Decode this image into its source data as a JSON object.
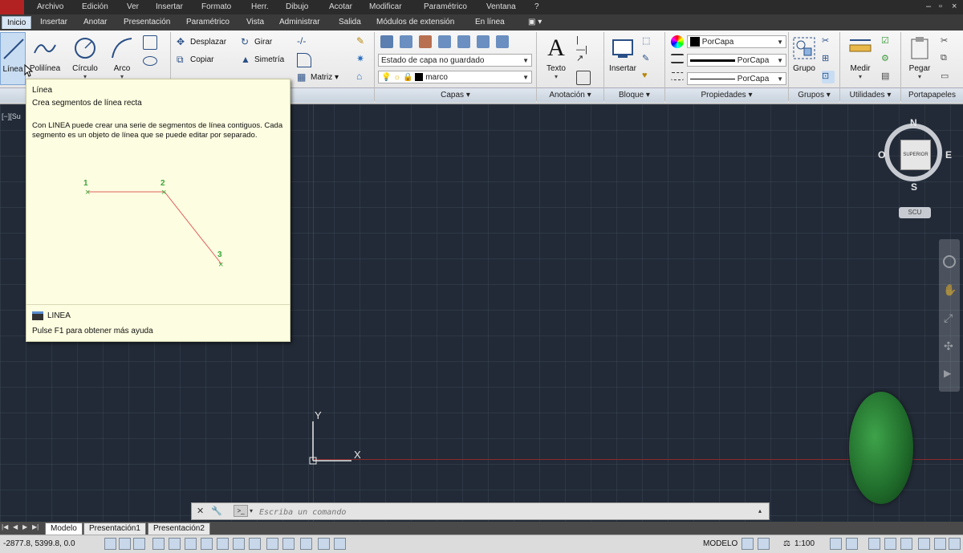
{
  "menubar": {
    "items": [
      "Archivo",
      "Edición",
      "Ver",
      "Insertar",
      "Formato",
      "Herr.",
      "Dibujo",
      "Acotar",
      "Modificar",
      "Paramétrico",
      "Ventana",
      "?"
    ]
  },
  "ribbon_tabs": [
    "Inicio",
    "Insertar",
    "Anotar",
    "Presentación",
    "Paramétrico",
    "Vista",
    "Administrar",
    "Salida",
    "Módulos de extensión",
    "En línea"
  ],
  "draw": {
    "line_label": "Línea",
    "polyline_label": "Polilínea",
    "circle_label": "Círculo",
    "arc_label": "Arco"
  },
  "modify": {
    "move_label": "Desplazar",
    "rotate_label": "Girar",
    "copy_label": "Copiar",
    "mirror_label": "Simetría",
    "array_label": "Matriz"
  },
  "layers": {
    "state_combo": "Estado de capa no guardado",
    "layer_combo": "marco",
    "panel_label": "Capas"
  },
  "annotation": {
    "text_label": "Texto",
    "panel_label": "Anotación"
  },
  "block": {
    "insert_label": "Insertar",
    "panel_label": "Bloque"
  },
  "properties": {
    "color_value": "PorCapa",
    "lineweight_value": "PorCapa",
    "linetype_value": "PorCapa",
    "panel_label": "Propiedades"
  },
  "groups": {
    "group_label": "Grupo",
    "panel_label": "Grupos"
  },
  "utilities": {
    "measure_label": "Medir",
    "panel_label": "Utilidades"
  },
  "clipboard": {
    "paste_label": "Pegar",
    "panel_label": "Portapapeles"
  },
  "tooltip": {
    "title": "Línea",
    "subtitle": "Crea segmentos de línea recta",
    "description": "Con LINEA puede crear una serie de segmentos de línea contiguos. Cada segmento es un objeto de línea que se puede editar por separado.",
    "point_labels": [
      "1",
      "2",
      "3"
    ],
    "command_name": "LINEA",
    "help_text": "Pulse F1 para obtener más ayuda"
  },
  "viewport": {
    "label": "[−][Su",
    "viewcube": {
      "north": "N",
      "south": "S",
      "east": "E",
      "west": "O",
      "face": "SUPERIOR",
      "ucs_label": "SCU"
    },
    "ucs_axes": {
      "x": "X",
      "y": "Y"
    }
  },
  "command_line": {
    "placeholder": "Escriba un comando"
  },
  "layout_tabs": [
    "Modelo",
    "Presentación1",
    "Presentación2"
  ],
  "status": {
    "coordinates": "-2877.8, 5399.8, 0.0",
    "model_label": "MODELO",
    "scale_label": "1:100"
  },
  "colors": {
    "accent": "#5a8fd0",
    "canvas_bg": "#222a37",
    "tooltip_bg": "#fdfde1",
    "red_line": "#e06060",
    "point_marker": "#3aa63a"
  }
}
